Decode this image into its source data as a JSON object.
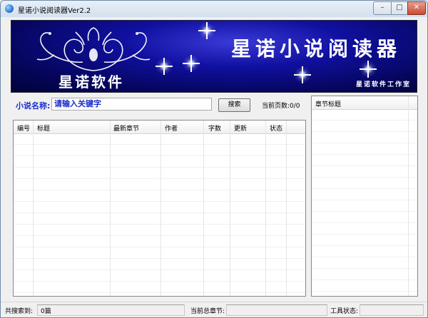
{
  "window": {
    "title": "星诺小说阅读器Ver2.2",
    "controls": {
      "minimize": "–",
      "maximize": "□",
      "close": "✕"
    }
  },
  "banner": {
    "logo_text": "星诺软件",
    "brand_text": "星诺小说阅读器",
    "studio_text": "星诺软件工作室"
  },
  "search": {
    "label": "小说名称:",
    "value": "请输入关键字",
    "button_label": "搜索",
    "page_count": "当前页数:0/0"
  },
  "results": {
    "columns": [
      "编号",
      "标题",
      "最新章节",
      "作者",
      "字数",
      "更新",
      "状态"
    ],
    "rows": []
  },
  "chapters": {
    "columns": [
      "章节标题"
    ],
    "rows": []
  },
  "status": {
    "found_label": "共搜索到:",
    "found_value": "0篇",
    "total_label": "当前总章节:",
    "total_value": "",
    "tool_label": "工具状态:",
    "tool_value": ""
  },
  "icons": {
    "app": "globe-icon"
  }
}
